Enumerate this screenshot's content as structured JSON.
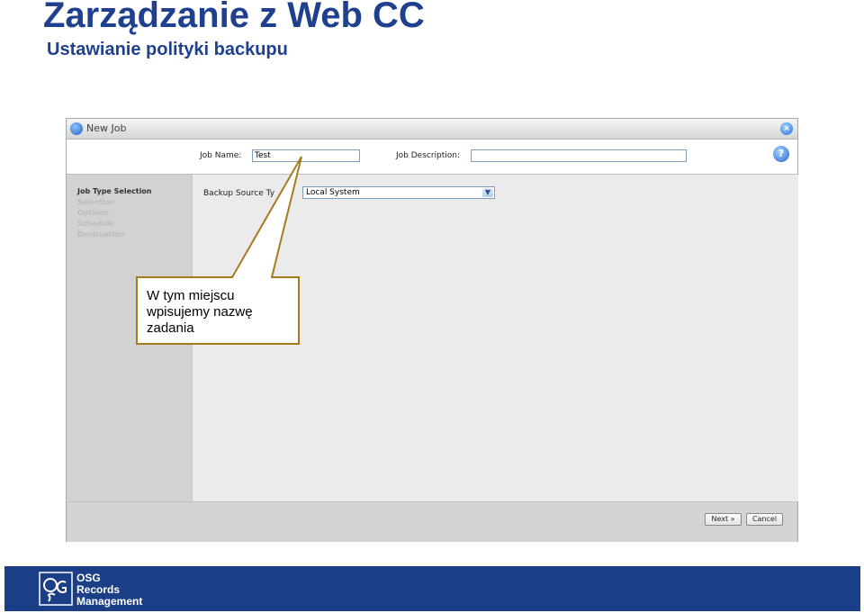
{
  "slide": {
    "title": "Zarządzanie z Web CC",
    "subtitle": "Ustawianie polityki backupu"
  },
  "window": {
    "title": "New Job",
    "job_name_label": "Job Name:",
    "job_name_value": "Test",
    "job_description_label": "Job Description:",
    "job_description_value": "",
    "help_icon": "?"
  },
  "nav": {
    "items": [
      {
        "label": "Job Type Selection",
        "active": true
      },
      {
        "label": "Selection",
        "active": false
      },
      {
        "label": "Options",
        "active": false
      },
      {
        "label": "Schedule",
        "active": false
      },
      {
        "label": "Destination",
        "active": false
      }
    ]
  },
  "content": {
    "backup_source_label": "Backup Source Ty",
    "backup_source_value": "Local System"
  },
  "buttons": {
    "next": "Next »",
    "cancel": "Cancel"
  },
  "callout": {
    "text": "W tym miejscu wpisujemy nazwę zadania"
  },
  "brand": {
    "line1": "OSG",
    "line2": "Records",
    "line3": "Management"
  },
  "colors": {
    "title": "#1f3f8f",
    "brand_bar": "#1b3f86",
    "callout_border": "#a87a1e"
  }
}
